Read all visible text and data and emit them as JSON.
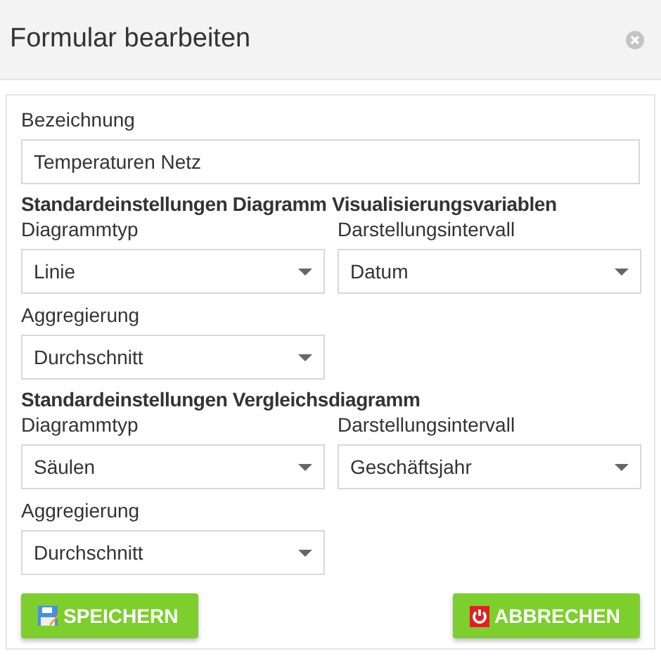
{
  "dialog": {
    "title": "Formular bearbeiten"
  },
  "name_field": {
    "label": "Bezeichnung",
    "value": "Temperaturen Netz"
  },
  "sections": [
    {
      "title": "Standardeinstellungen Diagramm Visualisierungsvariablen",
      "fields": [
        {
          "label": "Diagrammtyp",
          "value": "Linie"
        },
        {
          "label": "Darstellungsintervall",
          "value": "Datum"
        },
        {
          "label": "Aggregierung",
          "value": "Durchschnitt"
        }
      ]
    },
    {
      "title": "Standardeinstellungen Vergleichsdiagramm",
      "fields": [
        {
          "label": "Diagrammtyp",
          "value": "Säulen"
        },
        {
          "label": "Darstellungsintervall",
          "value": "Geschäftsjahr"
        },
        {
          "label": "Aggregierung",
          "value": "Durchschnitt"
        }
      ]
    }
  ],
  "buttons": [
    {
      "kind": "save",
      "label": "SPEICHERN"
    },
    {
      "kind": "cancel",
      "label": "ABBRECHEN"
    }
  ]
}
